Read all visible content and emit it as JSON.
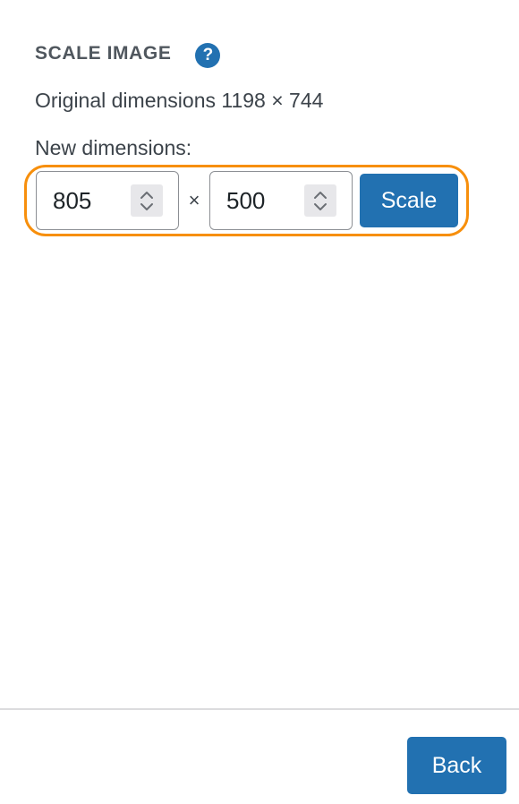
{
  "scale_image": {
    "title": "SCALE IMAGE",
    "help_icon": "question-mark-icon",
    "help_glyph": "?",
    "original_dimensions": "Original dimensions 1198 × 744",
    "new_dimensions_label": "New dimensions:",
    "width_value": "805",
    "height_value": "500",
    "times_symbol": "×",
    "scale_label": "Scale"
  },
  "footer": {
    "back_label": "Back"
  },
  "colors": {
    "accent": "#2271b1",
    "highlight": "#f78f0c",
    "text": "#3c434a",
    "title": "#50575e"
  }
}
